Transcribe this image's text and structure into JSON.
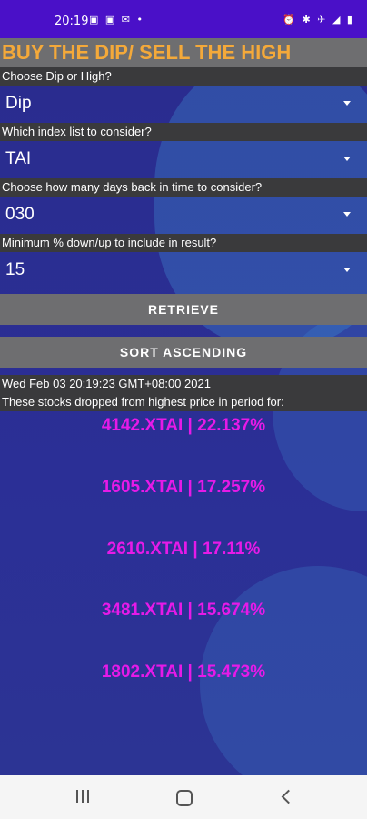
{
  "status_bar": {
    "time": "20:19",
    "left_icons": "▣ ▣ ✉ •",
    "right_icons": "⏰ ✱ ✈ ◢ ▮"
  },
  "app": {
    "title": "BUY THE DIP/ SELL THE HIGH"
  },
  "form": {
    "dip_or_high": {
      "label": "Choose Dip or High?",
      "value": "Dip"
    },
    "index_list": {
      "label": "Which index list to consider?",
      "value": "TAI"
    },
    "days_back": {
      "label": "Choose how many days back in time to consider?",
      "value": "030"
    },
    "min_percent": {
      "label": "Minimum % down/up to include in result?",
      "value": "15"
    }
  },
  "buttons": {
    "retrieve": "RETRIEVE",
    "sort": "SORT ASCENDING"
  },
  "results": {
    "timestamp": "Wed Feb 03 20:19:23 GMT+08:00 2021",
    "description": "These stocks dropped from highest price in period for:",
    "items": [
      "4142.XTAI | 22.137%",
      "1605.XTAI | 17.257%",
      "2610.XTAI | 17.11%",
      "3481.XTAI | 15.674%",
      "1802.XTAI | 15.473%"
    ]
  }
}
